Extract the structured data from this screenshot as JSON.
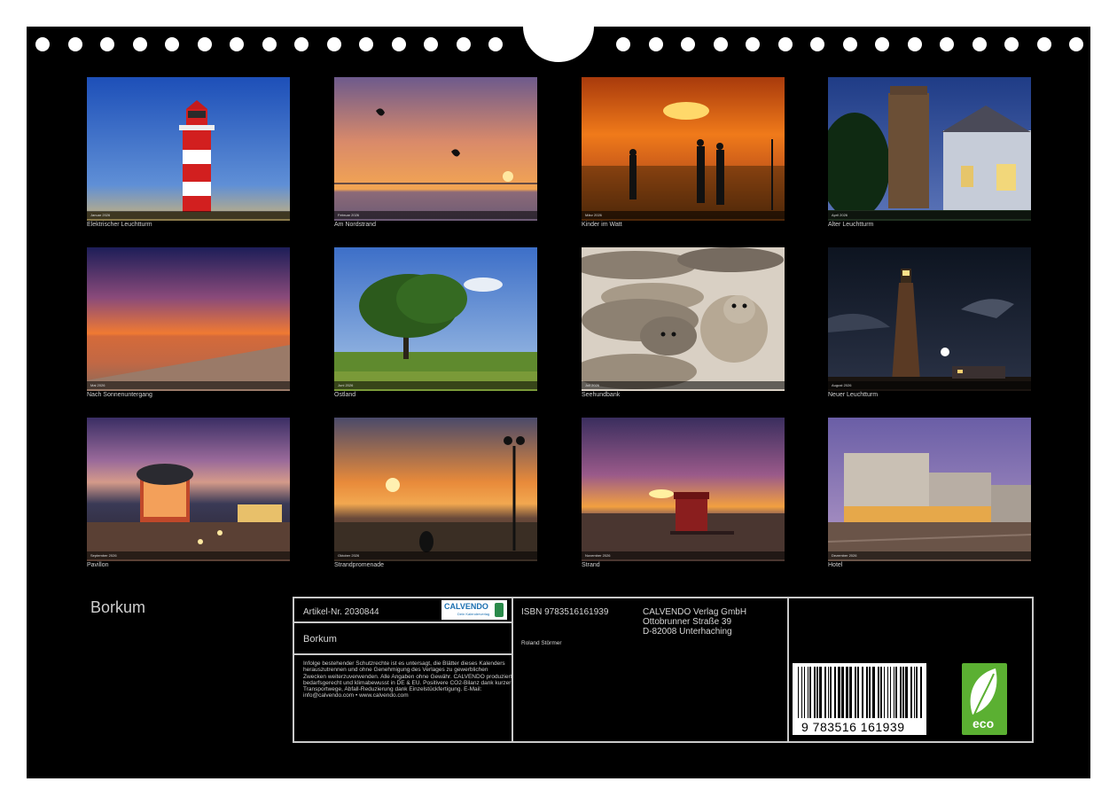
{
  "photos": [
    {
      "caption": "Elektrischer Leuchtturm",
      "month": "Januar 2026"
    },
    {
      "caption": "Am Nordstrand",
      "month": "Februar 2026"
    },
    {
      "caption": "Kinder im Watt",
      "month": "März 2026"
    },
    {
      "caption": "Alter Leuchtturm",
      "month": "April 2026"
    },
    {
      "caption": "Nach Sonnenuntergang",
      "month": "Mai 2026"
    },
    {
      "caption": "Ostland",
      "month": "Juni 2026"
    },
    {
      "caption": "Seehundbank",
      "month": "Juli 2026"
    },
    {
      "caption": "Neuer Leuchtturm",
      "month": "August 2026"
    },
    {
      "caption": "Pavillon",
      "month": "September 2026"
    },
    {
      "caption": "Strandpromenade",
      "month": "Oktober 2026"
    },
    {
      "caption": "Strand",
      "month": "November 2026"
    },
    {
      "caption": "Hotel",
      "month": "Dezember 2026"
    }
  ],
  "title": "Borkum",
  "info": {
    "article": "Artikel-Nr. 2030844",
    "logo_text": "CALVENDO",
    "logo_sub": "Dein Kalenderverlag",
    "product_title": "Borkum",
    "legal": "Infolge bestehender Schutzrechte ist es untersagt, die Blätter dieses Kalenders herauszutrennen und ohne Genehmigung des Verlages zu gewerblichen Zwecken weiterzuverwenden. Alle Angaben ohne Gewähr. CALVENDO produziert bedarfsgerecht und klimabewusst in DE & EU. Positivere CO2-Bilanz dank kurzer Transportwege, Abfall-Reduzierung dank Einzelstückfertigung. E-Mail: info@calvendo.com • www.calvendo.com",
    "isbn": "ISBN 9783516161939",
    "author": "Roland Störmer",
    "publisher_lines": [
      "CALVENDO Verlag GmbH",
      "Ottobrunner Straße 39",
      "D-82008 Unterhaching"
    ],
    "barcode_digits": "9 783516 161939",
    "eco_label": "eco"
  }
}
